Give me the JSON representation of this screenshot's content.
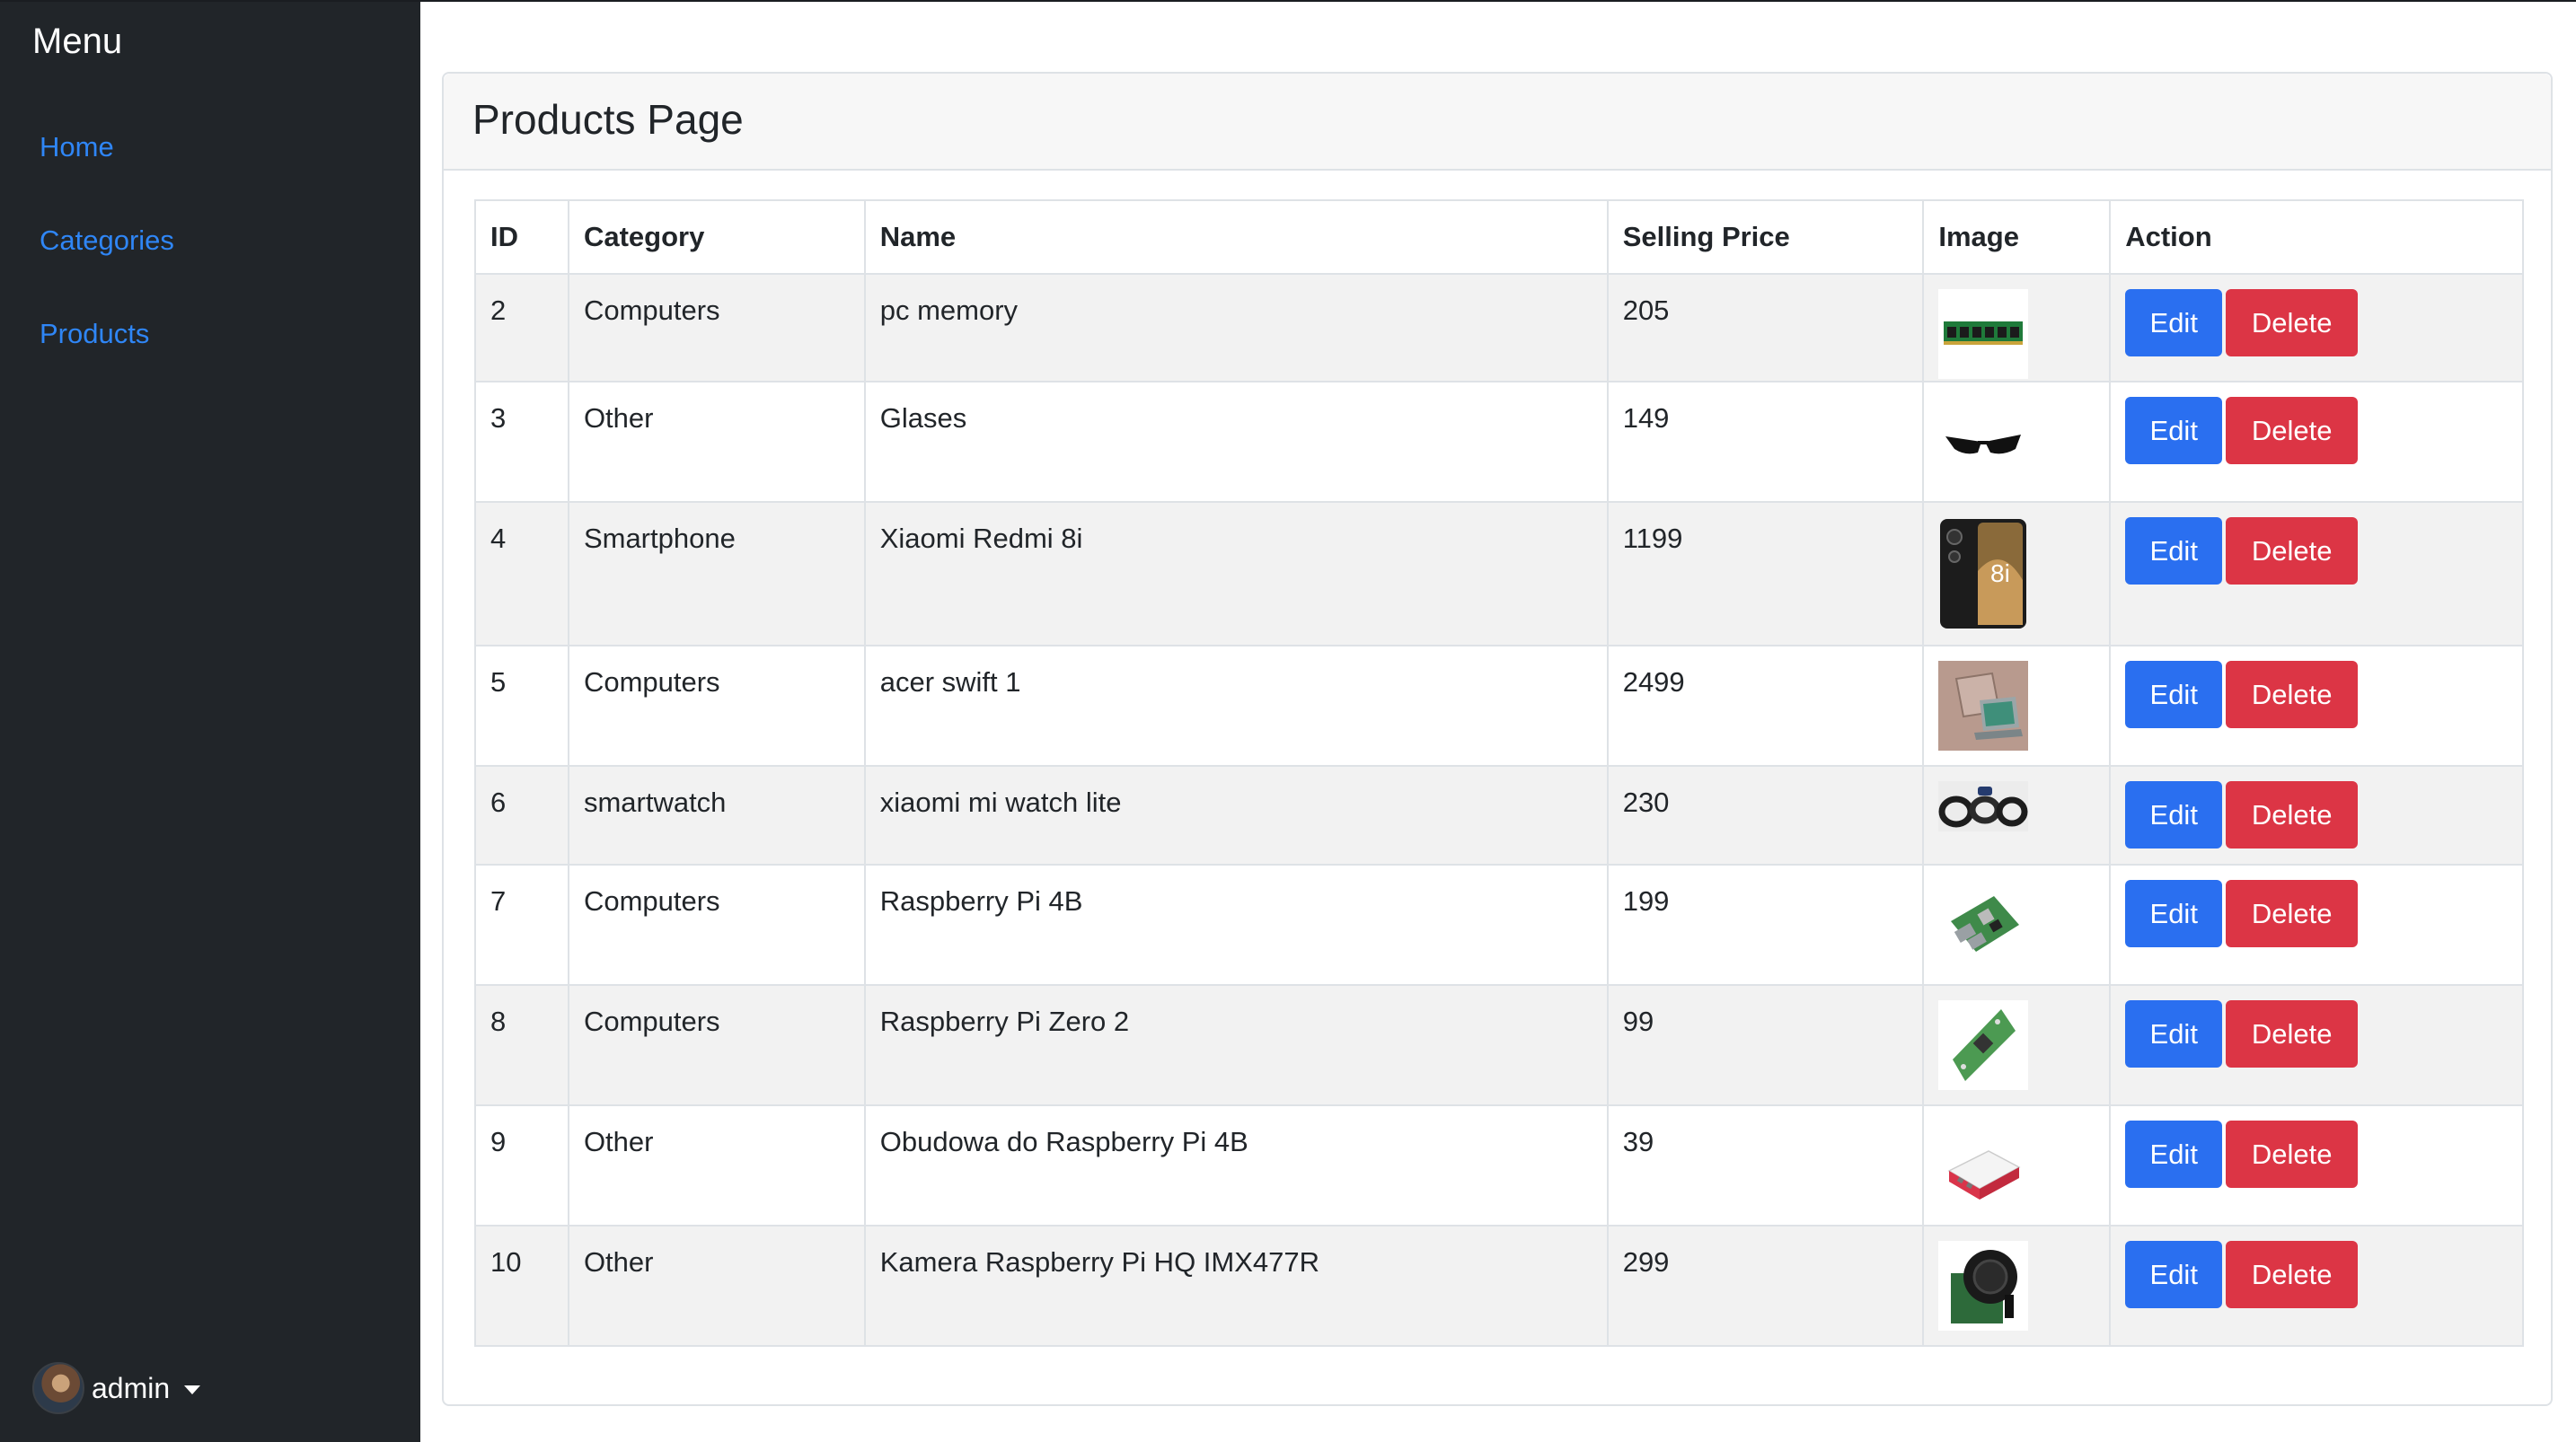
{
  "sidebar": {
    "title": "Menu",
    "items": [
      {
        "label": "Home"
      },
      {
        "label": "Categories"
      },
      {
        "label": "Products"
      }
    ],
    "user": {
      "name": "admin"
    }
  },
  "page": {
    "title": "Products Page"
  },
  "table": {
    "headers": [
      "ID",
      "Category",
      "Name",
      "Selling Price",
      "Image",
      "Action"
    ],
    "rows": [
      {
        "id": "2",
        "category": "Computers",
        "name": "pc memory",
        "price": "205",
        "image_icon": "ram-module-icon"
      },
      {
        "id": "3",
        "category": "Other",
        "name": "Glases",
        "price": "149",
        "image_icon": "sunglasses-icon"
      },
      {
        "id": "4",
        "category": "Smartphone",
        "name": "Xiaomi Redmi 8i",
        "price": "1199",
        "image_icon": "smartphone-icon",
        "image_text": "8i"
      },
      {
        "id": "5",
        "category": "Computers",
        "name": "acer swift 1",
        "price": "2499",
        "image_icon": "laptop-icon"
      },
      {
        "id": "6",
        "category": "smartwatch",
        "name": "xiaomi mi watch lite",
        "price": "230",
        "image_icon": "smartwatch-icon"
      },
      {
        "id": "7",
        "category": "Computers",
        "name": "Raspberry Pi 4B",
        "price": "199",
        "image_icon": "circuit-board-icon"
      },
      {
        "id": "8",
        "category": "Computers",
        "name": "Raspberry Pi Zero 2",
        "price": "99",
        "image_icon": "circuit-board-icon"
      },
      {
        "id": "9",
        "category": "Other",
        "name": "Obudowa do Raspberry Pi 4B",
        "price": "39",
        "image_icon": "case-icon"
      },
      {
        "id": "10",
        "category": "Other",
        "name": "Kamera Raspberry Pi HQ IMX477R",
        "price": "299",
        "image_icon": "camera-module-icon"
      }
    ],
    "edit_label": "Edit",
    "delete_label": "Delete"
  },
  "colors": {
    "sidebar_bg": "#212529",
    "link": "#2f86f6",
    "edit_button": "#2a6ff0",
    "delete_button": "#dc3545",
    "stripe": "#f2f2f2"
  }
}
